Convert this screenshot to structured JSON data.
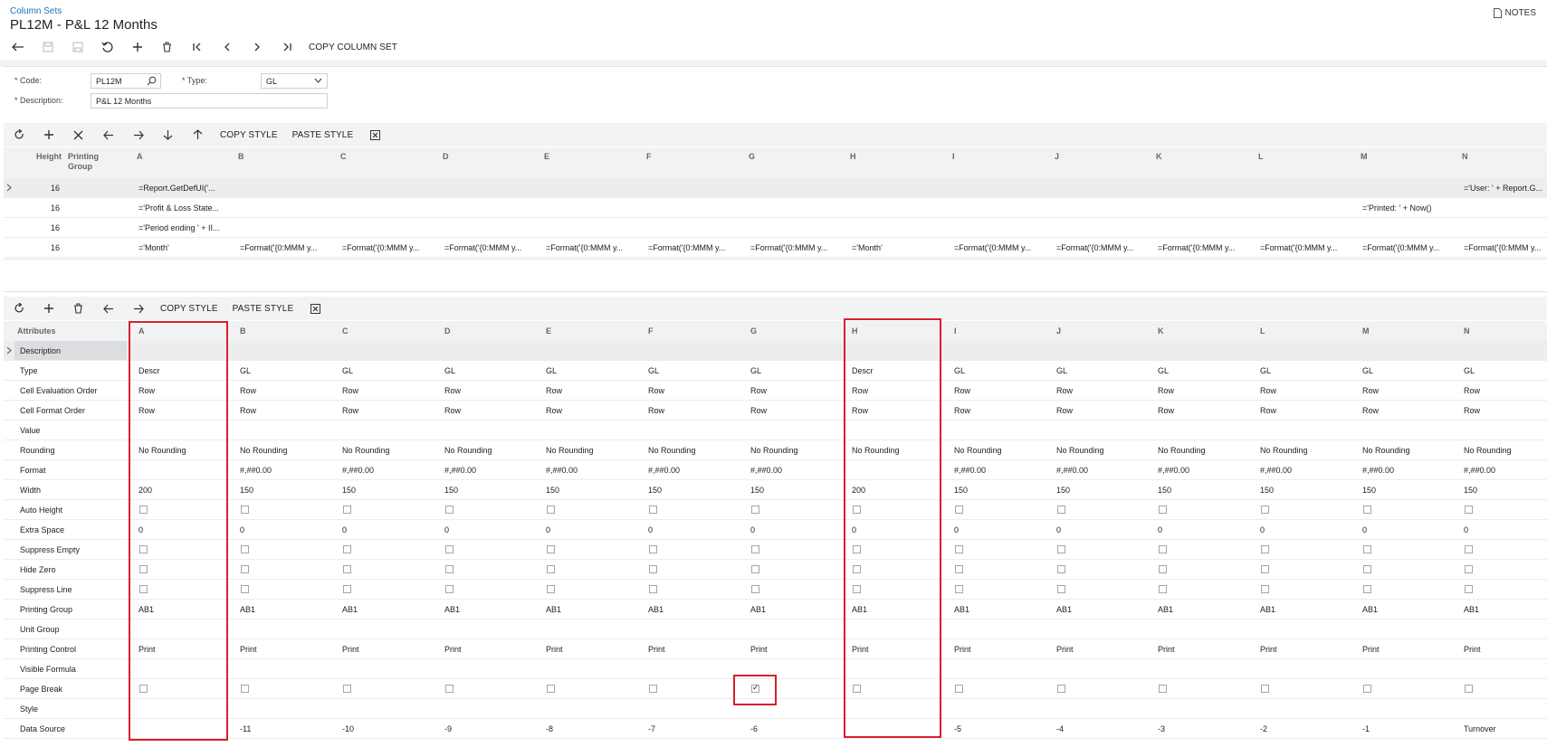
{
  "header": {
    "breadcrumb": "Column Sets",
    "title": "PL12M - P&L 12 Months",
    "notes": "NOTES",
    "copy_column_set": "COPY COLUMN SET"
  },
  "form": {
    "code_label": "Code:",
    "code_value": "PL12M",
    "type_label": "Type:",
    "type_value": "GL",
    "description_label": "Description:",
    "description_value": "P&L 12 Months"
  },
  "grid1": {
    "copy_style": "COPY STYLE",
    "paste_style": "PASTE STYLE",
    "headers": {
      "height": "Height",
      "printing_group_1": "Printing",
      "printing_group_2": "Group"
    },
    "columns": [
      "A",
      "B",
      "C",
      "D",
      "E",
      "F",
      "G",
      "H",
      "I",
      "J",
      "K",
      "L",
      "M",
      "N"
    ],
    "rows": [
      {
        "height": "16",
        "cells": [
          "=Report.GetDefUI('...",
          "",
          "",
          "",
          "",
          "",
          "",
          "",
          "",
          "",
          "",
          "",
          "",
          "='User: ' + Report.G..."
        ]
      },
      {
        "height": "16",
        "cells": [
          "='Profit & Loss State...",
          "",
          "",
          "",
          "",
          "",
          "",
          "",
          "",
          "",
          "",
          "",
          "='Printed: ' + Now()",
          ""
        ]
      },
      {
        "height": "16",
        "cells": [
          "='Period ending ' + II...",
          "",
          "",
          "",
          "",
          "",
          "",
          "",
          "",
          "",
          "",
          "",
          "",
          ""
        ]
      },
      {
        "height": "16",
        "cells": [
          "='Month'",
          "=Format('{0:MMM y...",
          "=Format('{0:MMM y...",
          "=Format('{0:MMM y...",
          "=Format('{0:MMM y...",
          "=Format('{0:MMM y...",
          "=Format('{0:MMM y...",
          "='Month'",
          "=Format('{0:MMM y...",
          "=Format('{0:MMM y...",
          "=Format('{0:MMM y...",
          "=Format('{0:MMM y...",
          "=Format('{0:MMM y...",
          "=Format('{0:MMM y..."
        ]
      }
    ]
  },
  "grid2": {
    "copy_style": "COPY STYLE",
    "paste_style": "PASTE STYLE",
    "attributes_header": "Attributes",
    "columns": [
      "A",
      "B",
      "C",
      "D",
      "E",
      "F",
      "G",
      "H",
      "I",
      "J",
      "K",
      "L",
      "M",
      "N"
    ],
    "rows": [
      {
        "label": "Description",
        "kind": "text",
        "values": [
          "",
          "",
          "",
          "",
          "",
          "",
          "",
          "",
          "",
          "",
          "",
          "",
          "",
          ""
        ]
      },
      {
        "label": "Type",
        "kind": "text",
        "values": [
          "Descr",
          "GL",
          "GL",
          "GL",
          "GL",
          "GL",
          "GL",
          "Descr",
          "GL",
          "GL",
          "GL",
          "GL",
          "GL",
          "GL"
        ]
      },
      {
        "label": "Cell Evaluation Order",
        "kind": "text",
        "values": [
          "Row",
          "Row",
          "Row",
          "Row",
          "Row",
          "Row",
          "Row",
          "Row",
          "Row",
          "Row",
          "Row",
          "Row",
          "Row",
          "Row"
        ]
      },
      {
        "label": "Cell Format Order",
        "kind": "text",
        "values": [
          "Row",
          "Row",
          "Row",
          "Row",
          "Row",
          "Row",
          "Row",
          "Row",
          "Row",
          "Row",
          "Row",
          "Row",
          "Row",
          "Row"
        ]
      },
      {
        "label": "Value",
        "kind": "text",
        "values": [
          "",
          "",
          "",
          "",
          "",
          "",
          "",
          "",
          "",
          "",
          "",
          "",
          "",
          ""
        ]
      },
      {
        "label": "Rounding",
        "kind": "text",
        "values": [
          "No Rounding",
          "No Rounding",
          "No Rounding",
          "No Rounding",
          "No Rounding",
          "No Rounding",
          "No Rounding",
          "No Rounding",
          "No Rounding",
          "No Rounding",
          "No Rounding",
          "No Rounding",
          "No Rounding",
          "No Rounding"
        ]
      },
      {
        "label": "Format",
        "kind": "text",
        "values": [
          "",
          "#,##0.00",
          "#,##0.00",
          "#,##0.00",
          "#,##0.00",
          "#,##0.00",
          "#,##0.00",
          "",
          "#,##0.00",
          "#,##0.00",
          "#,##0.00",
          "#,##0.00",
          "#,##0.00",
          "#,##0.00"
        ]
      },
      {
        "label": "Width",
        "kind": "text",
        "values": [
          "200",
          "150",
          "150",
          "150",
          "150",
          "150",
          "150",
          "200",
          "150",
          "150",
          "150",
          "150",
          "150",
          "150"
        ]
      },
      {
        "label": "Auto Height",
        "kind": "check",
        "values": [
          false,
          false,
          false,
          false,
          false,
          false,
          false,
          false,
          false,
          false,
          false,
          false,
          false,
          false
        ]
      },
      {
        "label": "Extra Space",
        "kind": "text",
        "values": [
          "0",
          "0",
          "0",
          "0",
          "0",
          "0",
          "0",
          "0",
          "0",
          "0",
          "0",
          "0",
          "0",
          "0"
        ]
      },
      {
        "label": "Suppress Empty",
        "kind": "check",
        "values": [
          false,
          false,
          false,
          false,
          false,
          false,
          false,
          false,
          false,
          false,
          false,
          false,
          false,
          false
        ]
      },
      {
        "label": "Hide Zero",
        "kind": "check",
        "values": [
          false,
          false,
          false,
          false,
          false,
          false,
          false,
          false,
          false,
          false,
          false,
          false,
          false,
          false
        ]
      },
      {
        "label": "Suppress Line",
        "kind": "check",
        "values": [
          false,
          false,
          false,
          false,
          false,
          false,
          false,
          false,
          false,
          false,
          false,
          false,
          false,
          false
        ]
      },
      {
        "label": "Printing Group",
        "kind": "text",
        "values": [
          "AB1",
          "AB1",
          "AB1",
          "AB1",
          "AB1",
          "AB1",
          "AB1",
          "AB1",
          "AB1",
          "AB1",
          "AB1",
          "AB1",
          "AB1",
          "AB1"
        ]
      },
      {
        "label": "Unit Group",
        "kind": "text",
        "values": [
          "",
          "",
          "",
          "",
          "",
          "",
          "",
          "",
          "",
          "",
          "",
          "",
          "",
          ""
        ]
      },
      {
        "label": "Printing Control",
        "kind": "text",
        "values": [
          "Print",
          "Print",
          "Print",
          "Print",
          "Print",
          "Print",
          "Print",
          "Print",
          "Print",
          "Print",
          "Print",
          "Print",
          "Print",
          "Print"
        ]
      },
      {
        "label": "Visible Formula",
        "kind": "text",
        "values": [
          "",
          "",
          "",
          "",
          "",
          "",
          "",
          "",
          "",
          "",
          "",
          "",
          "",
          ""
        ]
      },
      {
        "label": "Page Break",
        "kind": "check",
        "values": [
          false,
          false,
          false,
          false,
          false,
          false,
          true,
          false,
          false,
          false,
          false,
          false,
          false,
          false
        ]
      },
      {
        "label": "Style",
        "kind": "text",
        "values": [
          "",
          "",
          "",
          "",
          "",
          "",
          "",
          "",
          "",
          "",
          "",
          "",
          "",
          ""
        ]
      },
      {
        "label": "Data Source",
        "kind": "text",
        "values": [
          "",
          "-11",
          "-10",
          "-9",
          "-8",
          "-7",
          "-6",
          "",
          "-5",
          "-4",
          "-3",
          "-2",
          "-1",
          "Turnover"
        ]
      }
    ]
  },
  "colors": {
    "accent": "#1a6fb5",
    "highlight": "#d8202a",
    "band": "#f2f3f5"
  }
}
